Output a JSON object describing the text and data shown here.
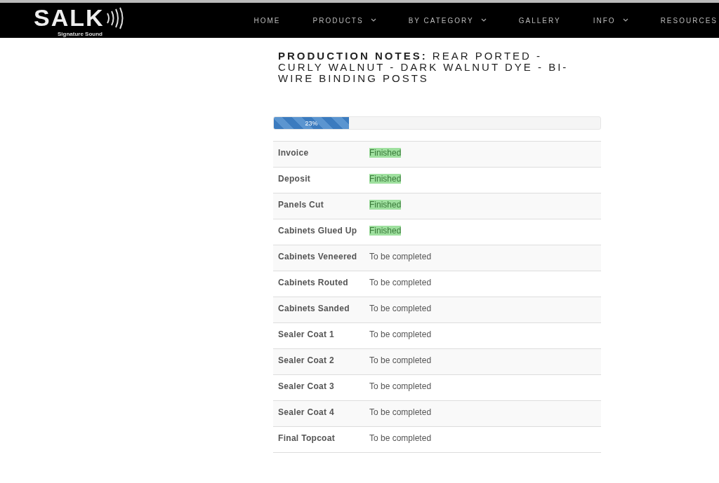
{
  "logo": {
    "name": "SALK",
    "tagline": "Signature Sound"
  },
  "nav": [
    {
      "label": "HOME",
      "has_menu": false
    },
    {
      "label": "PRODUCTS",
      "has_menu": true
    },
    {
      "label": "BY CATEGORY",
      "has_menu": true
    },
    {
      "label": "GALLERY",
      "has_menu": false
    },
    {
      "label": "INFO",
      "has_menu": true
    },
    {
      "label": "RESOURCES",
      "has_menu": false
    }
  ],
  "heading": {
    "title": "PRODUCTION NOTES:",
    "text": "REAR PORTED - CURLY WALNUT - DARK WALNUT DYE - BI-WIRE BINDING POSTS"
  },
  "progress": {
    "level": 0.23,
    "reading": "23%"
  },
  "steps": [
    {
      "name": "Invoice",
      "status": "Finished",
      "done": true
    },
    {
      "name": "Deposit",
      "status": "Finished",
      "done": true
    },
    {
      "name": "Panels Cut",
      "status": "Finished",
      "done": true
    },
    {
      "name": "Cabinets Glued Up",
      "status": "Finished",
      "done": true
    },
    {
      "name": "Cabinets Veneered",
      "status": "To be completed",
      "done": false
    },
    {
      "name": "Cabinets Routed",
      "status": "To be completed",
      "done": false
    },
    {
      "name": "Cabinets Sanded",
      "status": "To be completed",
      "done": false
    },
    {
      "name": "Sealer Coat 1",
      "status": "To be completed",
      "done": false
    },
    {
      "name": "Sealer Coat 2",
      "status": "To be completed",
      "done": false
    },
    {
      "name": "Sealer Coat 3",
      "status": "To be completed",
      "done": false
    },
    {
      "name": "Sealer Coat 4",
      "status": "To be completed",
      "done": false
    },
    {
      "name": "Final Topcoat",
      "status": "To be completed",
      "done": false
    }
  ]
}
